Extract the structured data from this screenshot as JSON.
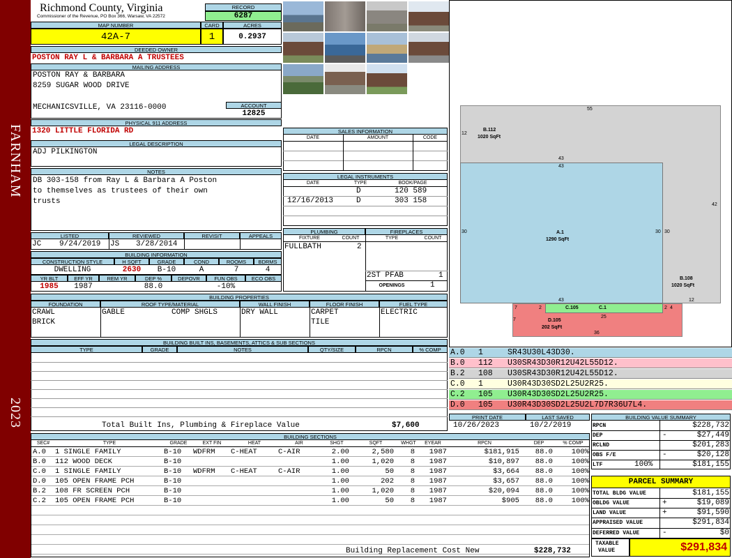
{
  "sidebar": {
    "district": "FARNHAM",
    "year": "2023"
  },
  "header": {
    "county": "Richmond County, Virginia",
    "commissioner": "Commissioner of the Revenue, PO Box 366, Warsaw, VA 22572",
    "record_label": "RECORD",
    "record": "6287",
    "map_label": "MAP NUMBER",
    "map": "42A-7",
    "card_label": "CARD",
    "card": "1",
    "acres_label": "ACRES",
    "acres": "0.2937"
  },
  "owner": {
    "deeded_label": "DEEDED OWNER",
    "deeded": "POSTON RAY L & BARBARA A TRUSTEES",
    "mailing_label": "MAILING ADDRESS",
    "mail1": "POSTON RAY & BARBARA",
    "mail2": "8259 SUGAR WOOD DRIVE",
    "mail3": "MECHANICSVILLE, VA 23116-0000",
    "account_label": "ACCOUNT",
    "account": "12825",
    "phys_label": "PHYSICAL 911 ADDRESS",
    "phys": "1320 LITTLE FLORIDA RD",
    "legal_label": "LEGAL DESCRIPTION",
    "legal": "ADJ PILKINGTON",
    "notes_label": "NOTES",
    "notes1": "DB 303-158 from Ray L & Barbara A Poston",
    "notes2": "to themselves as trustees of their own",
    "notes3": "trusts"
  },
  "review": {
    "listed_label": "LISTED",
    "reviewed_label": "REVIEWED",
    "revisit_label": "REVISIT",
    "appeals_label": "APPEALS",
    "listed_by": "JC",
    "listed_date": "9/24/2019",
    "reviewed_by": "JS",
    "reviewed_date": "3/28/2014"
  },
  "building_info": {
    "label": "BUILDING INFORMATION",
    "h_style": "CONSTRUCTION STYLE",
    "h_sqft": "H SQFT",
    "h_grade": "GRADE",
    "h_cond": "COND",
    "h_rooms": "ROOMS",
    "h_bdrms": "BDRMS",
    "style": "DWELLING",
    "sqft": "2630",
    "grade": "B-10",
    "cond": "A",
    "rooms": "7",
    "bdrms": "4",
    "h_yrblt": "YR BLT",
    "h_effyr": "EFF YR",
    "h_remyr": "REM YR",
    "h_dep": "DEP %",
    "h_depovr": "DEPOVR",
    "h_funobs": "FUN OBS",
    "h_ecoobs": "ECO OBS",
    "yrblt": "1985",
    "effyr": "1987",
    "dep": "88.0",
    "funobs": "-10%"
  },
  "props": {
    "label": "BUILDING PROPERTIES",
    "h_found": "FOUNDATION",
    "h_roof": "ROOF TYPE/MATERIAL",
    "h_wall": "WALL FINISH",
    "h_floor": "FLOOR FINISH",
    "h_fuel": "FUEL TYPE",
    "found1": "CRAWL",
    "found2": "BRICK",
    "roof1": "GABLE",
    "roof2": "COMP SHGLS",
    "wall": "DRY WALL",
    "floor1": "CARPET",
    "floor2": "TILE",
    "fuel": "ELECTRIC"
  },
  "builtins": {
    "label": "BUILDING BUILT INS, BASEMENTS, ATTICS & SUB SECTIONS",
    "h_type": "TYPE",
    "h_grade": "GRADE",
    "h_notes": "NOTES",
    "h_qty": "QTY/SIZE",
    "h_rpcn": "RPCN",
    "h_comp": "% COMP",
    "total_label": "Total Built Ins, Plumbing & Fireplace Value",
    "total": "$7,600"
  },
  "sales": {
    "label": "SALES INFORMATION",
    "h_date": "DATE",
    "h_amount": "AMOUNT",
    "h_code": "CODE"
  },
  "legal_inst": {
    "label": "LEGAL INSTRUMENTS",
    "h_date": "DATE",
    "h_type": "TYPE",
    "h_book": "BOOK/PAGE",
    "rows": [
      {
        "date": "",
        "type": "D",
        "book": "120 589"
      },
      {
        "date": "12/16/2013",
        "type": "D",
        "book": "303 158"
      }
    ]
  },
  "plumbing": {
    "label": "PLUMBING",
    "h_fixture": "FIXTURE",
    "h_count": "COUNT",
    "fixture": "FULLBATH",
    "count": "2"
  },
  "fireplaces": {
    "label": "FIREPLACES",
    "h_type": "TYPE",
    "h_count": "COUNT",
    "type": "2ST PFAB",
    "count": "1",
    "openings_label": "OPENINGS",
    "openings": "1"
  },
  "sketch": {
    "b112_label": "B.112",
    "b112_area": "1020 SqFt",
    "a1_label": "A.1",
    "a1_area": "1290 SqFt",
    "b108_label": "B.108",
    "b108_area": "1020 SqFt",
    "d105_label": "D.105",
    "d105_area": "202 SqFt",
    "c105_label": "C.105",
    "c1_label": "C.1",
    "dims": [
      "55",
      "12",
      "43",
      "43",
      "42",
      "30",
      "30",
      "30",
      "43",
      "12",
      "7",
      "2",
      "2",
      "4",
      "25",
      "7",
      "36"
    ]
  },
  "segments": [
    {
      "code": "A.0",
      "num": "1",
      "desc": "SR43U30L43D30.",
      "color": "#aed6e6"
    },
    {
      "code": "B.0",
      "num": "112",
      "desc": "U30SR43D30R12U42L55D12.",
      "color": "#ffc0cb"
    },
    {
      "code": "B.2",
      "num": "108",
      "desc": "U30SR43D30R12U42L55D12.",
      "color": "#d3d3d3"
    },
    {
      "code": "C.0",
      "num": "1",
      "desc": "U30R43D30SD2L25U2R25.",
      "color": "#ffffe0"
    },
    {
      "code": "C.2",
      "num": "105",
      "desc": "U30R43D30SD2L25U2R25.",
      "color": "#90ee90"
    },
    {
      "code": "D.0",
      "num": "105",
      "desc": "U30R43D30SD2L25U2L7D7R36U7L4.",
      "color": "#f08080"
    }
  ],
  "print": {
    "print_label": "PRINT DATE",
    "print_date": "10/26/2023",
    "saved_label": "LAST SAVED",
    "saved_date": "10/2/2019"
  },
  "sections": {
    "label": "BUILDING SECTIONS",
    "headers": [
      "SEC#",
      "TYPE",
      "GRADE",
      "EXT FIN",
      "HEAT",
      "AIR",
      "SHGT",
      "SQFT",
      "WHGT",
      "EYEAR",
      "RPCN",
      "DEP",
      "% COMP"
    ],
    "rows": [
      [
        "A.0",
        "1 SINGLE FAMILY",
        "B-10",
        "WDFRM",
        "C-HEAT",
        "C-AIR",
        "2.00",
        "2,580",
        "8",
        "1987",
        "$181,915",
        "88.0",
        "100%"
      ],
      [
        "B.0",
        "112 WOOD DECK",
        "B-10",
        "",
        "",
        "",
        "1.00",
        "1,020",
        "8",
        "1987",
        "$10,897",
        "88.0",
        "100%"
      ],
      [
        "C.0",
        "1 SINGLE FAMILY",
        "B-10",
        "WDFRM",
        "C-HEAT",
        "C-AIR",
        "1.00",
        "50",
        "8",
        "1987",
        "$3,664",
        "88.0",
        "100%"
      ],
      [
        "D.0",
        "105 OPEN FRAME PCH",
        "B-10",
        "",
        "",
        "",
        "1.00",
        "202",
        "8",
        "1987",
        "$3,657",
        "88.0",
        "100%"
      ],
      [
        "B.2",
        "108 FR SCREEN PCH",
        "B-10",
        "",
        "",
        "",
        "1.00",
        "1,020",
        "8",
        "1987",
        "$20,094",
        "88.0",
        "100%"
      ],
      [
        "C.2",
        "105 OPEN FRAME PCH",
        "B-10",
        "",
        "",
        "",
        "1.00",
        "50",
        "8",
        "1987",
        "$905",
        "88.0",
        "100%"
      ]
    ],
    "repl_label": "Building Replacement Cost New",
    "repl": "$228,732"
  },
  "value_summary": {
    "label": "BUILDING VALUE SUMMARY",
    "rows": [
      {
        "k": "RPCN",
        "sign": "",
        "v": "$228,732"
      },
      {
        "k": "DEP",
        "sign": "-",
        "v": "$27,449"
      },
      {
        "k": "RCLND",
        "sign": "",
        "v": "$201,283"
      },
      {
        "k": "OBS F/E",
        "sign": "-",
        "v": "$20,128"
      },
      {
        "k": "LTF",
        "sign": "100%",
        "v": "$181,155"
      }
    ]
  },
  "parcel": {
    "label": "PARCEL SUMMARY",
    "rows": [
      {
        "k": "TOTAL BLDG VALUE",
        "sign": "",
        "v": "$181,155"
      },
      {
        "k": "OBLDG VALUE",
        "sign": "+",
        "v": "$19,089"
      },
      {
        "k": "LAND VALUE",
        "sign": "+",
        "v": "$91,590"
      },
      {
        "k": "APPRAISED VALUE",
        "sign": "",
        "v": "$291,834"
      },
      {
        "k": "DEFERRED VALUE",
        "sign": "-",
        "v": "$0"
      }
    ],
    "taxable_label1": "TAXABLE",
    "taxable_label2": "VALUE",
    "taxable": "$291,834"
  }
}
